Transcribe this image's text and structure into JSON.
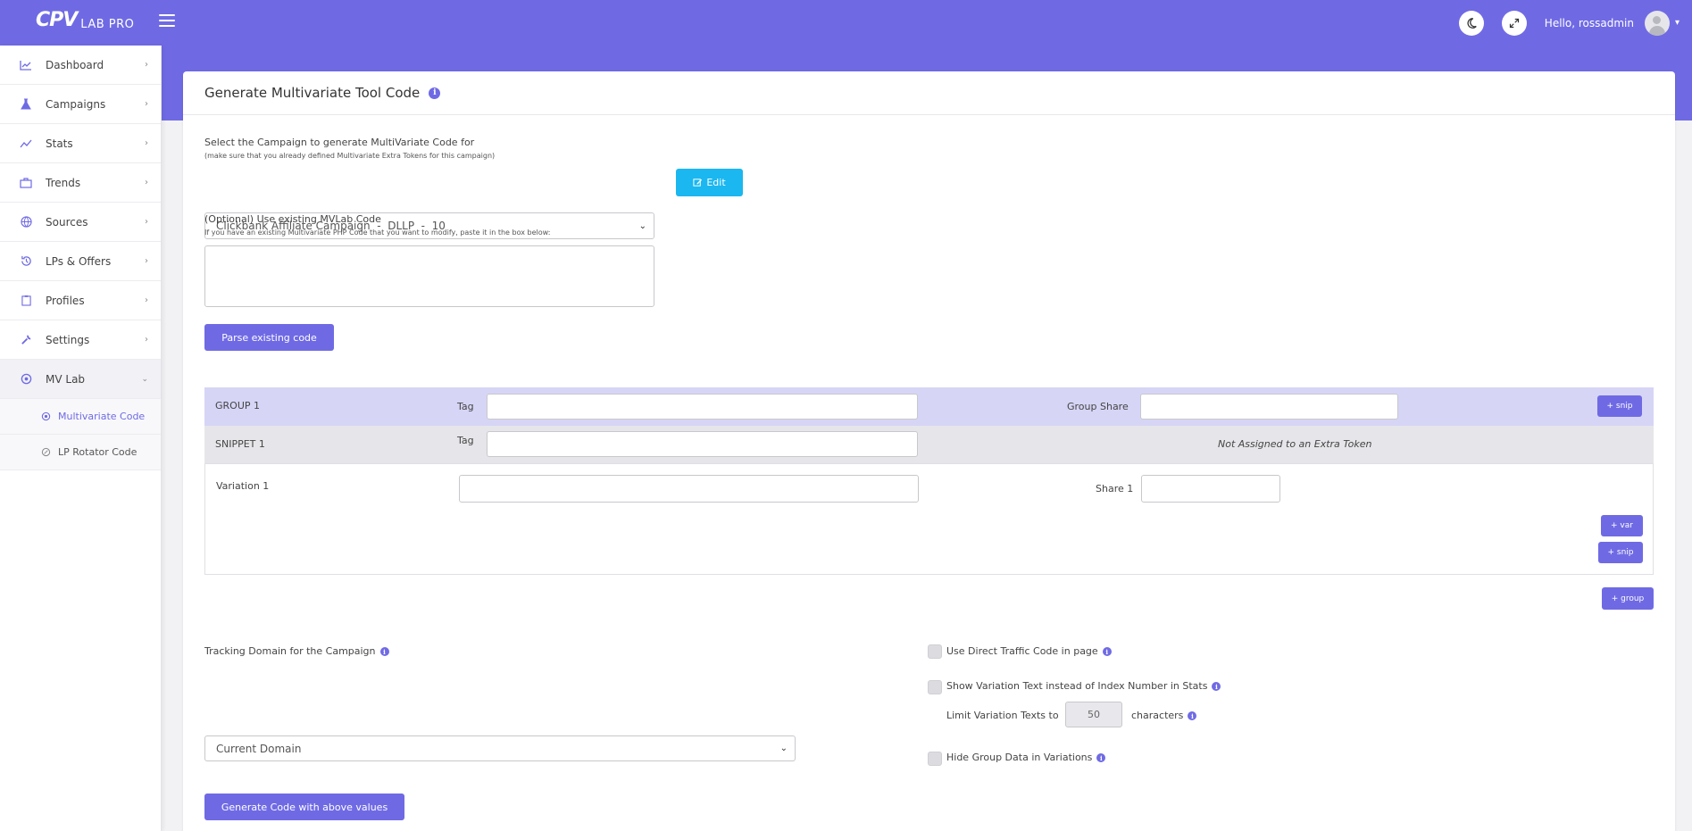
{
  "header": {
    "logo_cpv": "CPV",
    "logo_labpro": "LAB PRO",
    "greeting": "Hello, rossadmin",
    "dark_mode_icon": "moon-icon",
    "fullscreen_icon": "expand-icon"
  },
  "sidebar": {
    "items": [
      {
        "label": "Dashboard",
        "icon": "chart-line-icon"
      },
      {
        "label": "Campaigns",
        "icon": "flask-icon"
      },
      {
        "label": "Stats",
        "icon": "trend-icon"
      },
      {
        "label": "Trends",
        "icon": "briefcase-icon"
      },
      {
        "label": "Sources",
        "icon": "globe-icon"
      },
      {
        "label": "LPs & Offers",
        "icon": "history-icon"
      },
      {
        "label": "Profiles",
        "icon": "clipboard-icon"
      },
      {
        "label": "Settings",
        "icon": "wrench-icon"
      },
      {
        "label": "MV Lab",
        "icon": "mvlab-icon"
      }
    ],
    "subitems": [
      {
        "label": "Multivariate Code"
      },
      {
        "label": "LP Rotator Code"
      }
    ]
  },
  "page": {
    "title": "Generate Multivariate Tool Code",
    "campaign_label": "Select the Campaign to generate MultiVariate Code for",
    "campaign_hint": "(make sure that you already defined Multivariate Extra Tokens for this campaign)",
    "campaign_selected": "Clickbank Affiliate Campaign  -  DLLP  -  10",
    "edit_button": "Edit",
    "existing_label": "(Optional) Use existing MVLab Code",
    "existing_hint": "If you have an existing Multivariate PHP Code that you want to modify, paste it in the box below:",
    "parse_button": "Parse existing code"
  },
  "groups": {
    "group_label": "GROUP 1",
    "tag_label": "Tag",
    "group_share_label": "Group Share",
    "snip_button": "+ snip",
    "snippet_label": "SNIPPET 1",
    "snippet_status": "Not Assigned to an Extra Token",
    "variation_label": "Variation 1",
    "share_label": "Share 1",
    "var_button": "+ var",
    "snip_button2": "+ snip",
    "group_button": "+ group"
  },
  "options": {
    "tracking_label": "Tracking Domain for the Campaign",
    "tracking_selected": "Current Domain",
    "direct_traffic_label": "Use Direct Traffic Code in page",
    "show_variation_label": "Show Variation Text instead of Index Number in Stats",
    "limit_prefix": "Limit Variation Texts to",
    "limit_value": "50",
    "limit_suffix": "characters",
    "hide_group_label": "Hide Group Data in Variations",
    "generate_button": "Generate Code with above values"
  },
  "colors": {
    "accent": "#6f6ae4",
    "edit_button": "#1ab7f0",
    "group_row": "#d6d5f6",
    "snippet_row": "#e6e6ea"
  }
}
